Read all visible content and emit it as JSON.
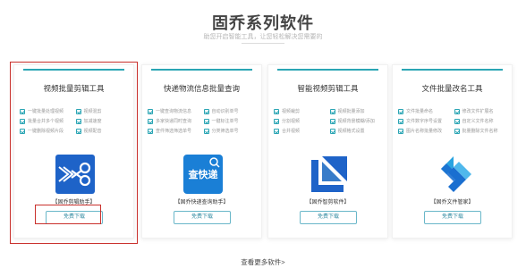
{
  "header": {
    "title": "固乔系列软件",
    "subtitle": "助您开启智能工具，让您轻松解决您需要的"
  },
  "cards": [
    {
      "title": "视频批量剪辑工具",
      "features": [
        "一键批量处理视频",
        "视频混剪",
        "批量合并多个视频",
        "加减速度",
        "一键删除视频片段",
        "视频配音"
      ],
      "icon": "scissors-icon",
      "icon_color": "#1e63c8",
      "app_name": "【固乔剪辑助手】",
      "button_label": "免费下载"
    },
    {
      "title": "快递物流信息批量查询",
      "features": [
        "一键查询物流信息",
        "自动识别单号",
        "多家快递同时查询",
        "一键标注单号",
        "查件筛选筛选单号",
        "分类筛选单号"
      ],
      "icon": "search-express-icon",
      "icon_color": "#1a7fd6",
      "icon_text": "查快递",
      "app_name": "【固乔快递查询助手】",
      "button_label": "免费下载"
    },
    {
      "title": "智能视频剪辑工具",
      "features": [
        "视频裁剪",
        "视频批量添加",
        "分割视频",
        "视频背景模糊/添加",
        "合并视频",
        "视频格式设置"
      ],
      "icon": "smart-edit-icon",
      "icon_color": "#1e63c8",
      "app_name": "【固乔智剪软件】",
      "button_label": "免费下载"
    },
    {
      "title": "文件批量改名工具",
      "features": [
        "文件批量命名",
        "修改文件扩展名",
        "文件数字序号设置",
        "自定义文件名称",
        "图片名称批量修改",
        "批量删除文件名称"
      ],
      "icon": "file-rename-icon",
      "icon_color": "#1a6fd0",
      "app_name": "【固乔文件管家】",
      "button_label": "免费下载"
    }
  ],
  "footer": {
    "more_label": "查看更多软件>"
  },
  "highlight_color": "#c9302c",
  "accent": "#2aa5b4"
}
